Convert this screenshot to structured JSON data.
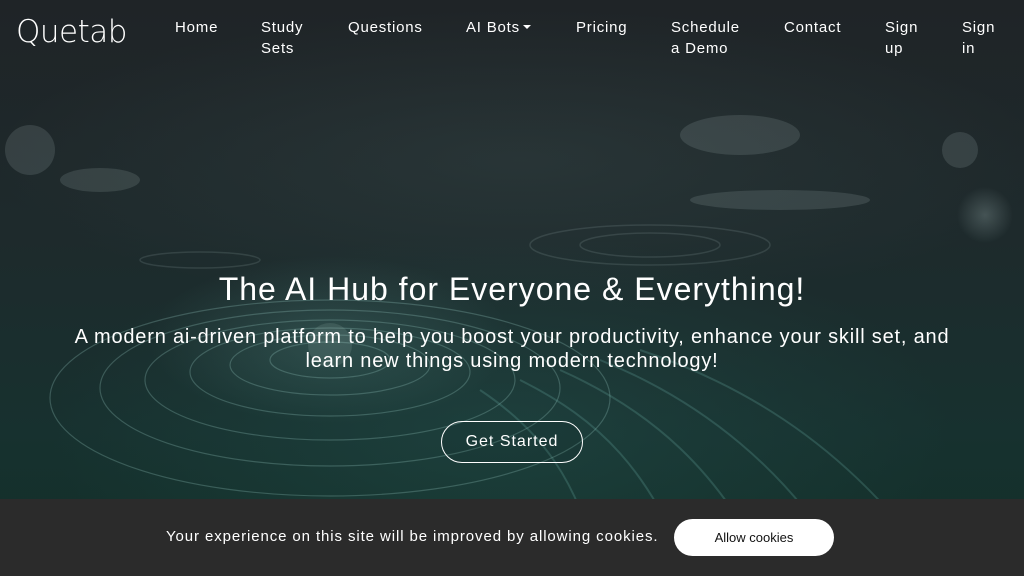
{
  "brand": {
    "name": "Quetab"
  },
  "nav": {
    "home": "Home",
    "study_sets": "Study Sets",
    "questions": "Questions",
    "ai_bots": "AI Bots",
    "pricing": "Pricing",
    "schedule_demo": "Schedule a Demo",
    "contact": "Contact",
    "sign_up": "Sign up",
    "sign_in": "Sign in"
  },
  "hero": {
    "title": "The AI Hub for Everyone & Everything!",
    "subtitle": "A modern ai-driven platform to help you boost your productivity, enhance your skill set, and learn new things using modern technology!",
    "cta_label": "Get Started"
  },
  "cookie_banner": {
    "message": "Your experience on this site will be improved by allowing cookies.",
    "button_label": "Allow cookies"
  },
  "icons": {
    "ai_bots_dropdown": "caret-down-icon"
  },
  "colors": {
    "nav_text": "#ffffff",
    "cookie_bar_bg": "#2b2b2b",
    "cookie_button_bg": "#ffffff",
    "hero_bg": "#1e2a2c"
  }
}
